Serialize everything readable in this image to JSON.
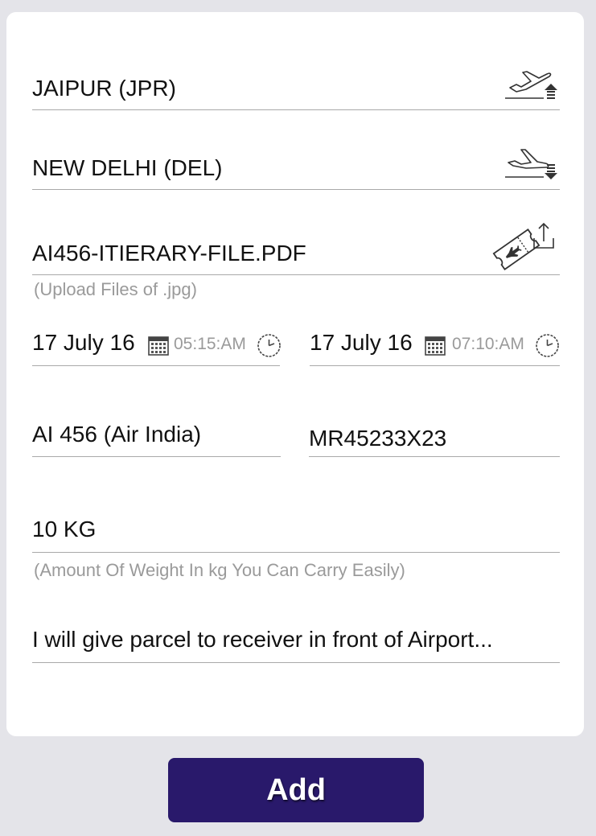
{
  "form": {
    "from": {
      "value": "JAIPUR (JPR)",
      "icon": "takeoff-icon"
    },
    "to": {
      "value": "NEW DELHI (DEL)",
      "icon": "landing-icon"
    },
    "itinerary": {
      "value": "AI456-ITIERARY-FILE.PDF",
      "hint": "(Upload Files of .jpg)",
      "icon": "ticket-upload-icon"
    },
    "departure": {
      "date": "17 July 16",
      "time": "05:15:AM"
    },
    "arrival": {
      "date": "17 July 16",
      "time": "07:10:AM"
    },
    "flight": {
      "value": "AI 456 (Air India)"
    },
    "pnr": {
      "value": "MR45233X23"
    },
    "weight": {
      "value": "10 KG",
      "hint": "(Amount Of Weight In kg You Can Carry Easily)"
    },
    "note": {
      "value": "I will give parcel to receiver in front of Airport..."
    }
  },
  "actions": {
    "add_label": "Add"
  },
  "colors": {
    "primary": "#29196b",
    "background": "#e4e4e9",
    "card": "#ffffff"
  }
}
